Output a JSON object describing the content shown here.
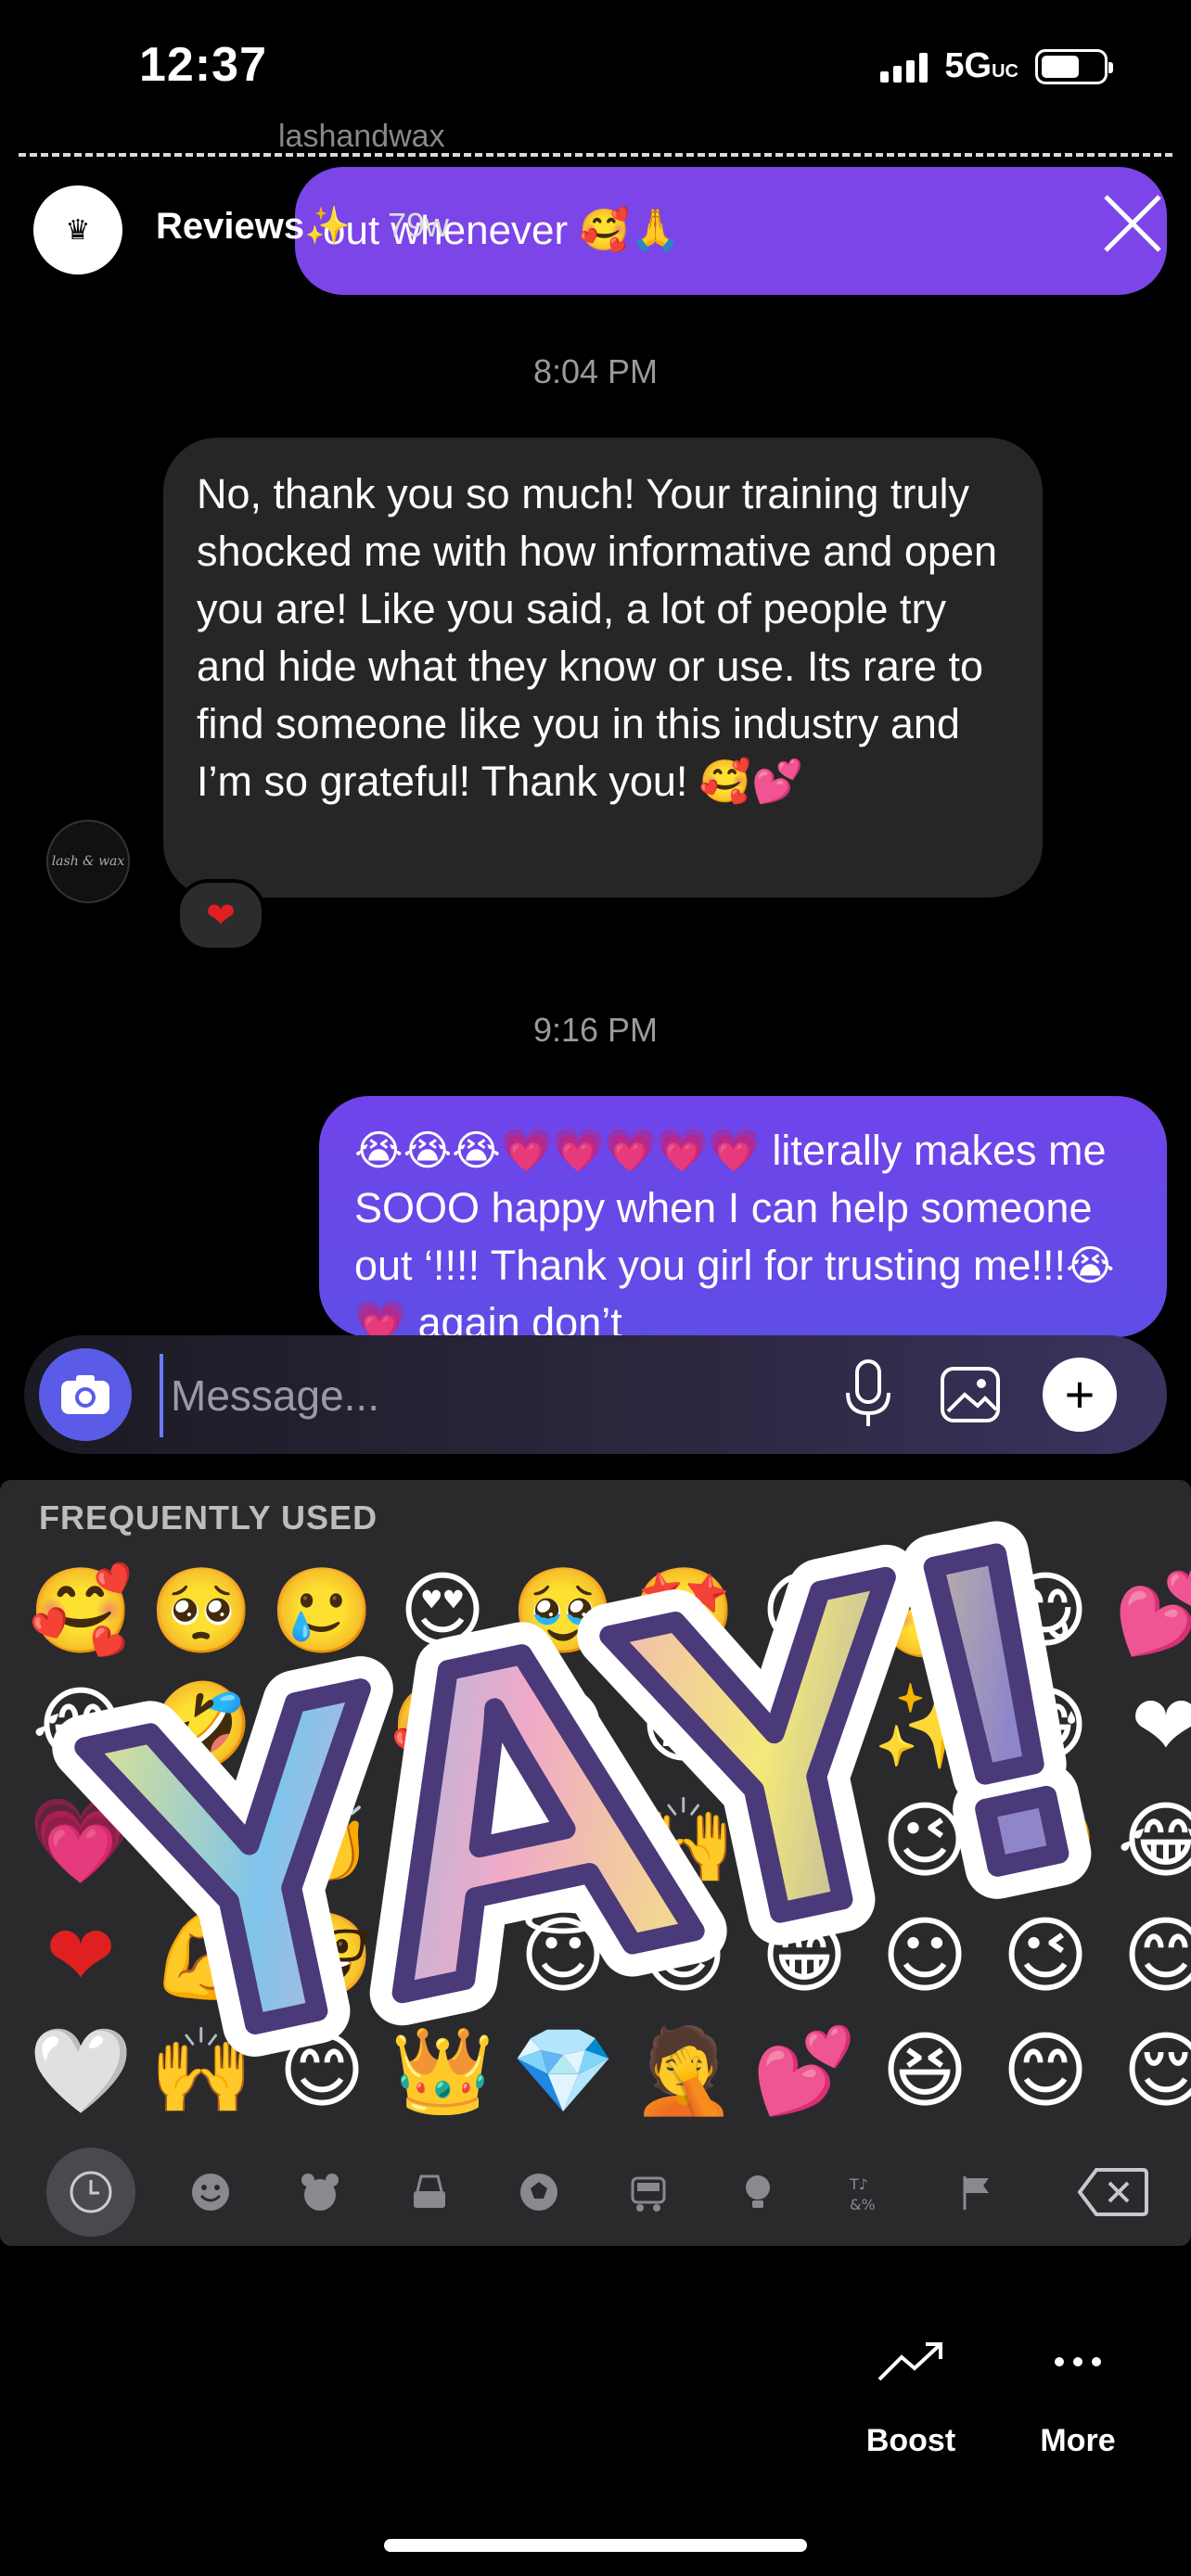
{
  "status_bar": {
    "time": "12:37",
    "network": "5G",
    "network_suffix": "UC"
  },
  "dm_header_ghost": "lashandwax",
  "story": {
    "account_name": "Reviews",
    "sparkle": "✨",
    "age": "79w"
  },
  "chat": {
    "top_sent_text": "out whenever 🥰🙏",
    "timestamp_1": "8:04 PM",
    "received_text": "No, thank you so much! Your training truly shocked me with how informative and open you are! Like you said, a lot of people try and hide what they know or use. Its rare to find someone like you in this industry and I’m so grateful! Thank you! 🥰💕",
    "reaction": "❤",
    "contact_avatar_text": "lash & wax",
    "timestamp_2": "9:16 PM",
    "sent_text": "😭😭😭💗💗💗💗💗 literally makes me SOOO happy when I can help someone out ‘!!!! Thank you girl for trusting me!!!😭💗 again don’t"
  },
  "composer": {
    "placeholder": "Message..."
  },
  "keyboard": {
    "section_title": "FREQUENTLY USED",
    "rows": [
      [
        "🥰",
        "🥺",
        "🥲",
        "😍",
        "🥹",
        "🤩",
        "😘",
        "🥳",
        "😋",
        "💕"
      ],
      [
        "😂",
        "🤣",
        "🙏",
        "🥰",
        "😭",
        "😩",
        "😅",
        "✨",
        "😅",
        "❤"
      ],
      [
        "💗",
        "🔥",
        "👏",
        "💯",
        "😊",
        "🙌",
        "🥲",
        "😉",
        "🤣",
        "😂"
      ],
      [
        "❤",
        "💪",
        "🤓",
        "😔",
        "😇",
        "😌",
        "😁",
        "☺",
        "😉",
        "😊"
      ],
      [
        "🤍",
        "🙌",
        "😊",
        "👑",
        "💎",
        "🤦",
        "💕",
        "😆",
        "😊",
        "😌"
      ]
    ],
    "categories": [
      "recent",
      "smileys",
      "animals",
      "food",
      "activity",
      "travel",
      "objects",
      "symbols",
      "flags"
    ]
  },
  "sticker_text": "YAY!",
  "actions": {
    "boost": "Boost",
    "more": "More"
  },
  "colors": {
    "sent_bubble": "#7b45e8",
    "received_bubble": "#262626",
    "camera_button": "#5a5ce8"
  }
}
